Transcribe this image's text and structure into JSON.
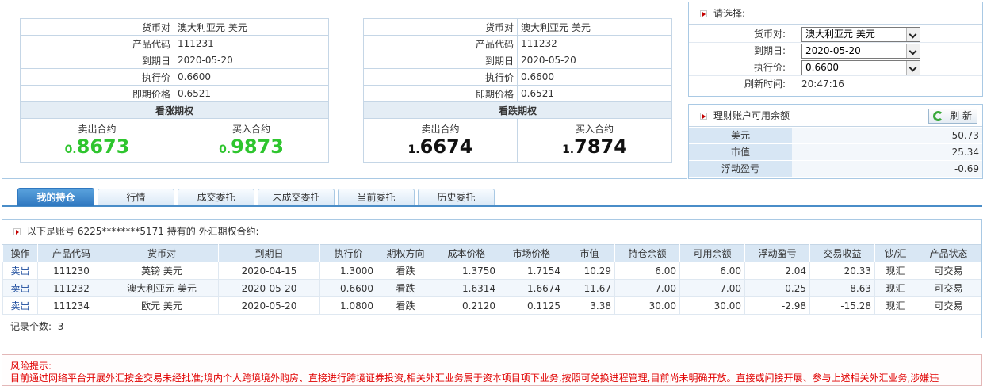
{
  "call_quote": {
    "rows": [
      {
        "k": "货币对",
        "v": "澳大利亚元 美元"
      },
      {
        "k": "产品代码",
        "v": "111231"
      },
      {
        "k": "到期日",
        "v": "2020-05-20"
      },
      {
        "k": "执行价",
        "v": "0.6600"
      },
      {
        "k": "即期价格",
        "v": "0.6521"
      }
    ],
    "title": "看涨期权",
    "sell_label": "卖出合约",
    "sell_prefix": "0.",
    "sell_main": "8673",
    "buy_label": "买入合约",
    "buy_prefix": "0.",
    "buy_main": "9873",
    "price_color": "#2ec52e"
  },
  "put_quote": {
    "rows": [
      {
        "k": "货币对",
        "v": "澳大利亚元 美元"
      },
      {
        "k": "产品代码",
        "v": "111232"
      },
      {
        "k": "到期日",
        "v": "2020-05-20"
      },
      {
        "k": "执行价",
        "v": "0.6600"
      },
      {
        "k": "即期价格",
        "v": "0.6521"
      }
    ],
    "title": "看跌期权",
    "sell_label": "卖出合约",
    "sell_prefix": "1.",
    "sell_main": "6674",
    "buy_label": "买入合约",
    "buy_prefix": "1.",
    "buy_main": "7874",
    "price_color": "#111111"
  },
  "selector": {
    "title": "请选择:",
    "currency_pair_label": "货币对:",
    "currency_pair_value": "澳大利亚元 美元",
    "expiry_label": "到期日:",
    "expiry_value": "2020-05-20",
    "strike_label": "执行价:",
    "strike_value": "0.6600",
    "refresh_time_label": "刷新时间:",
    "refresh_time_value": "20:47:16"
  },
  "balance": {
    "title": "理财账户可用余额",
    "refresh_label": "刷 新",
    "rows": [
      {
        "k": "美元",
        "v": "50.73"
      },
      {
        "k": "市值",
        "v": "25.34"
      },
      {
        "k": "浮动盈亏",
        "v": "-0.69"
      }
    ]
  },
  "tabs": [
    "我的持仓",
    "行情",
    "成交委托",
    "未成交委托",
    "当前委托",
    "历史委托"
  ],
  "holdings": {
    "title": "以下是账号 6225********5171 持有的 外汇期权合约:",
    "columns": [
      "操作",
      "产品代码",
      "货币对",
      "到期日",
      "执行价",
      "期权方向",
      "成本价格",
      "市场价格",
      "市值",
      "持仓余额",
      "可用余额",
      "浮动盈亏",
      "交易收益",
      "钞/汇",
      "产品状态"
    ],
    "rows": [
      [
        "卖出",
        "111230",
        "英镑 美元",
        "2020-04-15",
        "1.3000",
        "看跌",
        "1.3750",
        "1.7154",
        "10.29",
        "6.00",
        "6.00",
        "2.04",
        "20.33",
        "现汇",
        "可交易"
      ],
      [
        "卖出",
        "111232",
        "澳大利亚元 美元",
        "2020-05-20",
        "0.6600",
        "看跌",
        "1.6314",
        "1.6674",
        "11.67",
        "7.00",
        "7.00",
        "0.25",
        "8.63",
        "现汇",
        "可交易"
      ],
      [
        "卖出",
        "111234",
        "欧元 美元",
        "2020-05-20",
        "1.0800",
        "看跌",
        "0.2120",
        "0.1125",
        "3.38",
        "30.00",
        "30.00",
        "-2.98",
        "-15.28",
        "现汇",
        "可交易"
      ]
    ],
    "record_count_label": "记录个数:",
    "record_count": "3"
  },
  "risk": {
    "title": "风险提示:",
    "body": "目前通过网络平台开展外汇按金交易未经批准;境内个人跨境境外购房、直接进行跨境证券投资,相关外汇业务属于资本项目项下业务,按照可兑换进程管理,目前尚未明确开放。直接或间接开展、参与上述相关外汇业务,涉嫌违"
  }
}
